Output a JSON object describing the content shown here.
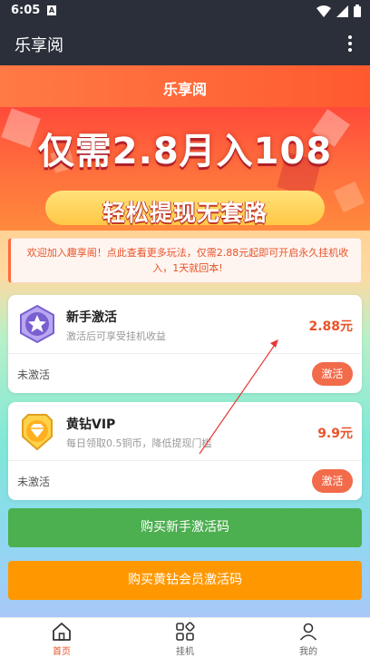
{
  "status_bar": {
    "time": "6:05",
    "notification_glyph": "A"
  },
  "app_bar": {
    "title": "乐享阅",
    "more_icon": "more-vertical-icon"
  },
  "page_header": {
    "title": "乐享阅"
  },
  "banner": {
    "headline": "仅需2.8月入108",
    "pill_text": "轻松提现无套路"
  },
  "notice": {
    "text": "欢迎加入趣享阁！点此查看更多玩法，仅需2.88元起即可开启永久挂机收入，1天就回本!"
  },
  "cards": [
    {
      "title": "新手激活",
      "desc": "激活后可享受挂机收益",
      "price": "2.88元",
      "status": "未激活",
      "button": "激活",
      "badge_icon": "purple-star-badge-icon"
    },
    {
      "title": "黄钻VIP",
      "desc": "每日领取0.5铜币，降低提现门槛",
      "price": "9.9元",
      "status": "未激活",
      "button": "激活",
      "badge_icon": "gold-diamond-badge-icon"
    }
  ],
  "buttons": {
    "buy_newbie": "购买新手激活码",
    "buy_vip": "购买黄钻会员激活码"
  },
  "bottom_nav": [
    {
      "label": "首页",
      "icon": "home-icon",
      "active": true
    },
    {
      "label": "挂机",
      "icon": "apps-grid-icon",
      "active": false
    },
    {
      "label": "我的",
      "icon": "user-icon",
      "active": false
    }
  ],
  "colors": {
    "accent": "#e8532a",
    "dark_bar": "#2b2f3a",
    "green_button": "#4caf50",
    "orange_button": "#ff9800",
    "annotation_arrow": "#e53935"
  }
}
